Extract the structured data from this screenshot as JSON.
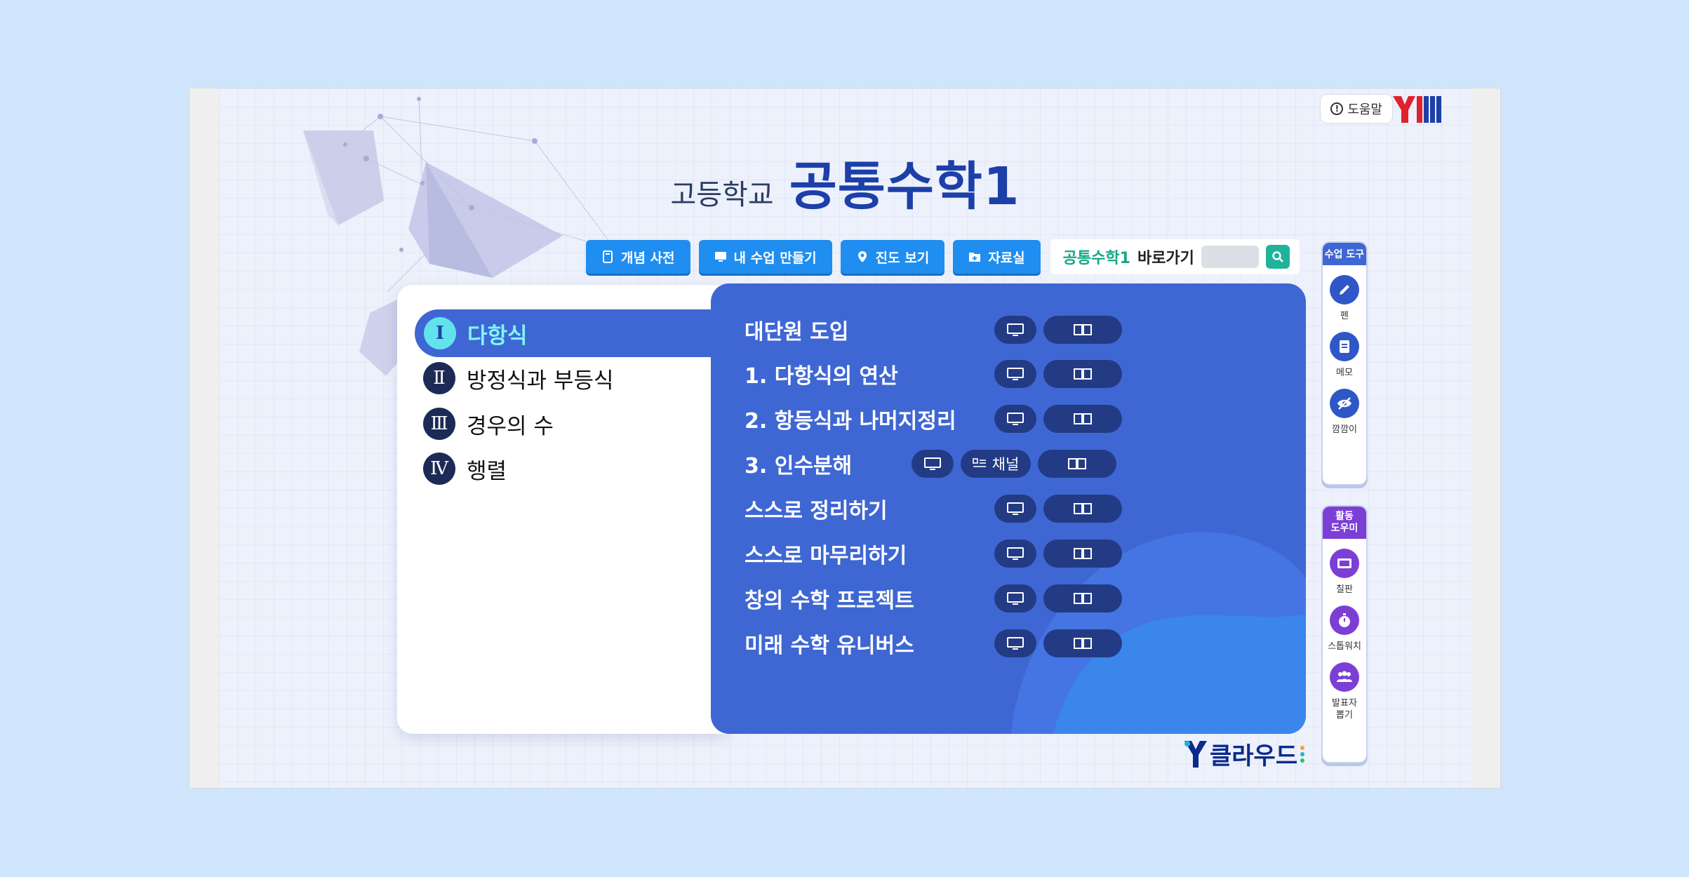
{
  "header": {
    "help_label": "도움말",
    "brand": "YBM",
    "subtitle": "고등학교",
    "title": "공통수학1"
  },
  "toolbar": {
    "buttons": [
      {
        "label": "개념 사전",
        "icon": "book-icon"
      },
      {
        "label": "내 수업 만들기",
        "icon": "monitor-icon"
      },
      {
        "label": "진도 보기",
        "icon": "location-pin-icon"
      },
      {
        "label": "자료실",
        "icon": "folder-icon"
      }
    ],
    "quick_link": {
      "course": "공통수학1",
      "label": "바로가기",
      "input_value": ""
    }
  },
  "units": [
    {
      "numeral": "Ⅰ",
      "label": "다항식",
      "active": true
    },
    {
      "numeral": "Ⅱ",
      "label": "방정식과 부등식",
      "active": false
    },
    {
      "numeral": "Ⅲ",
      "label": "경우의 수",
      "active": false
    },
    {
      "numeral": "Ⅳ",
      "label": "행렬",
      "active": false
    }
  ],
  "lessons": [
    {
      "title": "대단원 도입",
      "channel": false
    },
    {
      "title": "1. 다항식의 연산",
      "channel": false
    },
    {
      "title": "2. 항등식과 나머지정리",
      "channel": false
    },
    {
      "title": "3. 인수분해",
      "channel": true,
      "channel_label": "채널"
    },
    {
      "title": "스스로 정리하기",
      "channel": false
    },
    {
      "title": "스스로 마무리하기",
      "channel": false
    },
    {
      "title": "창의 수학 프로젝트",
      "channel": false
    },
    {
      "title": "미래 수학 유니버스",
      "channel": false
    }
  ],
  "class_tools": {
    "heading": "수업 도구",
    "items": [
      {
        "label": "펜",
        "icon": "pen-icon"
      },
      {
        "label": "메모",
        "icon": "memo-icon"
      },
      {
        "label": "깜깜이",
        "icon": "eye-slash-icon"
      }
    ]
  },
  "activity_tools": {
    "heading_line1": "활동",
    "heading_line2": "도우미",
    "items": [
      {
        "label": "칠판",
        "icon": "blackboard-icon"
      },
      {
        "label": "스톱워치",
        "icon": "stopwatch-icon"
      },
      {
        "label_line1": "발표자",
        "label_line2": "뽑기",
        "icon": "group-icon"
      }
    ]
  },
  "footer": {
    "logo_text": "클라우드"
  },
  "colors": {
    "accent": "#3f67d3",
    "button": "#1f8ef0",
    "title": "#1c3fa9",
    "activity": "#7b3fd6"
  }
}
